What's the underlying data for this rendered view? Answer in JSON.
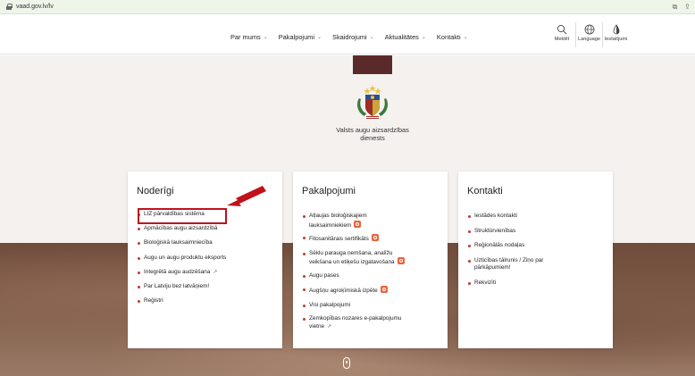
{
  "browser": {
    "url": "vaad.gov.lv/lv"
  },
  "nav": {
    "items": [
      {
        "label": "Par mums"
      },
      {
        "label": "Pakalpojumi"
      },
      {
        "label": "Skaidrojumi"
      },
      {
        "label": "Aktualitātes"
      },
      {
        "label": "Kontakti"
      }
    ]
  },
  "tools": {
    "search": "Meklēt",
    "language": "Language",
    "settings": "Iestatījumi"
  },
  "hero": {
    "agency_line1": "Valsts augu aizsardzības",
    "agency_line2": "dienests"
  },
  "cards": {
    "useful": {
      "title": "Noderīgi",
      "items": [
        "LIZ pārvaldības sistēma",
        "Apmācības augu aizsardzībā",
        "Bioloģiskā lauksaimniecība",
        "Augu un augu produktu eksports",
        "Integrētā augu audzēšana",
        "Par Latviju bez latvāņiem!",
        "Reģistri"
      ]
    },
    "services": {
      "title": "Pakalpojumi",
      "items": [
        [
          "Atļaujas bioloģiskajiem",
          "lauksaimniekiem"
        ],
        [
          "Fitosanitārais sertifikāts"
        ],
        [
          "Sēklu parauga ņemšana, analīžu",
          "veikšana un etiķešu izgatavošana"
        ],
        [
          "Augu pases"
        ],
        [
          "Augšņu agroķīmiskā izpēte"
        ],
        [
          "Visi pakalpojumi"
        ],
        [
          "Zemkopības nozares e-pakalpojumu",
          "vietne"
        ]
      ]
    },
    "contacts": {
      "title": "Kontakti",
      "items": [
        [
          "Iestādes kontakti"
        ],
        [
          "Struktūrvienības"
        ],
        [
          "Reģionālās nodaļas"
        ],
        [
          "Uzticības tālrunis / Ziņo par",
          "pārkāpumiem!"
        ],
        [
          "Rekvizīti"
        ]
      ]
    }
  },
  "colors": {
    "highlight": "#c0121b",
    "bullet": "#c0392b",
    "brand": "#5a2a2a",
    "badge": "#e9643a"
  },
  "icons": [
    "lock-icon",
    "chevron-down-icon",
    "search-icon",
    "globe-icon",
    "contrast-icon",
    "external-link-icon",
    "service-badge-icon",
    "red-arrow-icon",
    "scroll-mouse-icon"
  ]
}
